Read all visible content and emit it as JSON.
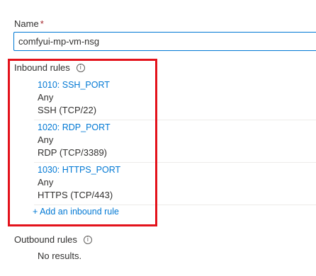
{
  "name_field": {
    "label": "Name",
    "required_marker": "*",
    "value": "comfyui-mp-vm-nsg"
  },
  "inbound": {
    "label": "Inbound rules",
    "info_icon": "info-icon",
    "rules": [
      {
        "link": "1010: SSH_PORT",
        "action": "Any",
        "service": "SSH (TCP/22)"
      },
      {
        "link": "1020: RDP_PORT",
        "action": "Any",
        "service": "RDP (TCP/3389)"
      },
      {
        "link": "1030: HTTPS_PORT",
        "action": "Any",
        "service": "HTTPS (TCP/443)"
      }
    ],
    "add_rule_label": "+ Add an inbound rule"
  },
  "outbound": {
    "label": "Outbound rules",
    "info_icon": "info-icon",
    "empty_text": "No results."
  },
  "colors": {
    "link": "#0078d4",
    "highlight": "#e3121b",
    "required": "#a4262c"
  }
}
